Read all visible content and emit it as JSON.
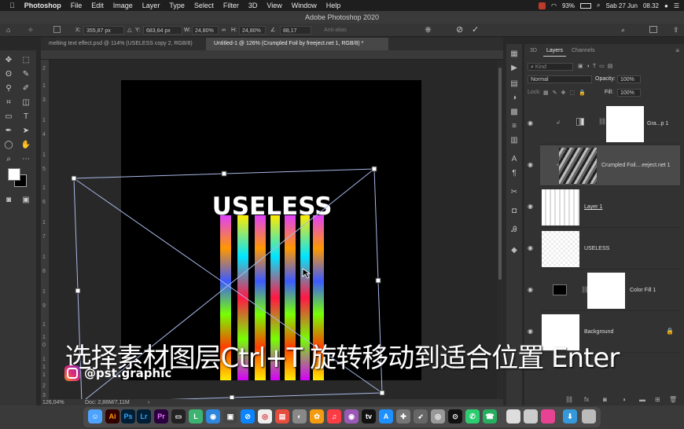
{
  "menubar": {
    "app": "Photoshop",
    "items": [
      "File",
      "Edit",
      "Image",
      "Layer",
      "Type",
      "Select",
      "Filter",
      "3D",
      "View",
      "Window",
      "Help"
    ],
    "battery": "93%",
    "date": "Sab 27 Jun",
    "time": "08.32"
  },
  "window": {
    "title": "Adobe Photoshop 2020"
  },
  "options": {
    "x_label": "X:",
    "x": "355,87 px",
    "y_label": "Y:",
    "y": "683,64 px",
    "w_label": "W:",
    "w": "24,80%",
    "h_label": "H:",
    "h": "24,80%",
    "angle": "88,17",
    "antialias": "Anti-alias"
  },
  "tabs": [
    {
      "label": "melting text effect.psd @ 114% (USELESS copy 2, RGB/8)"
    },
    {
      "label": "Untitled-1 @ 126% (Crumpled Foil by freeject.net 1, RGB/8) *"
    }
  ],
  "canvas": {
    "text": "USELESS"
  },
  "ruler_left": [
    "2",
    "1",
    "3",
    "1",
    "4",
    "1",
    "5",
    "1",
    "6",
    "1",
    "7",
    "1",
    "8",
    "1",
    "9",
    "1",
    "1",
    "0",
    "1",
    "1",
    "1",
    "2",
    "3"
  ],
  "status": {
    "zoom": "126,04%",
    "doc": "Doc: 2,86M/7,11M"
  },
  "panel": {
    "tabs": [
      "3D",
      "Layers",
      "Channels"
    ],
    "kind": "Kind",
    "blend": "Normal",
    "opacity_label": "Opacity:",
    "opacity": "100%",
    "lock_label": "Lock:",
    "fill_label": "Fill:",
    "fill": "100%"
  },
  "layers": [
    {
      "name": "Gra...p 1"
    },
    {
      "name": "Crumpled Foil....eeject.net 1"
    },
    {
      "name": "Layer 1"
    },
    {
      "name": "USELESS"
    },
    {
      "name": "Color Fill 1"
    },
    {
      "name": "Background"
    }
  ],
  "subtitle": "选择素材图层Ctrl+T 旋转移动到适合位置 Enter",
  "handle": "@pst.graphic",
  "dock": [
    "Ai",
    "Ps",
    "Lr",
    "Pr"
  ]
}
